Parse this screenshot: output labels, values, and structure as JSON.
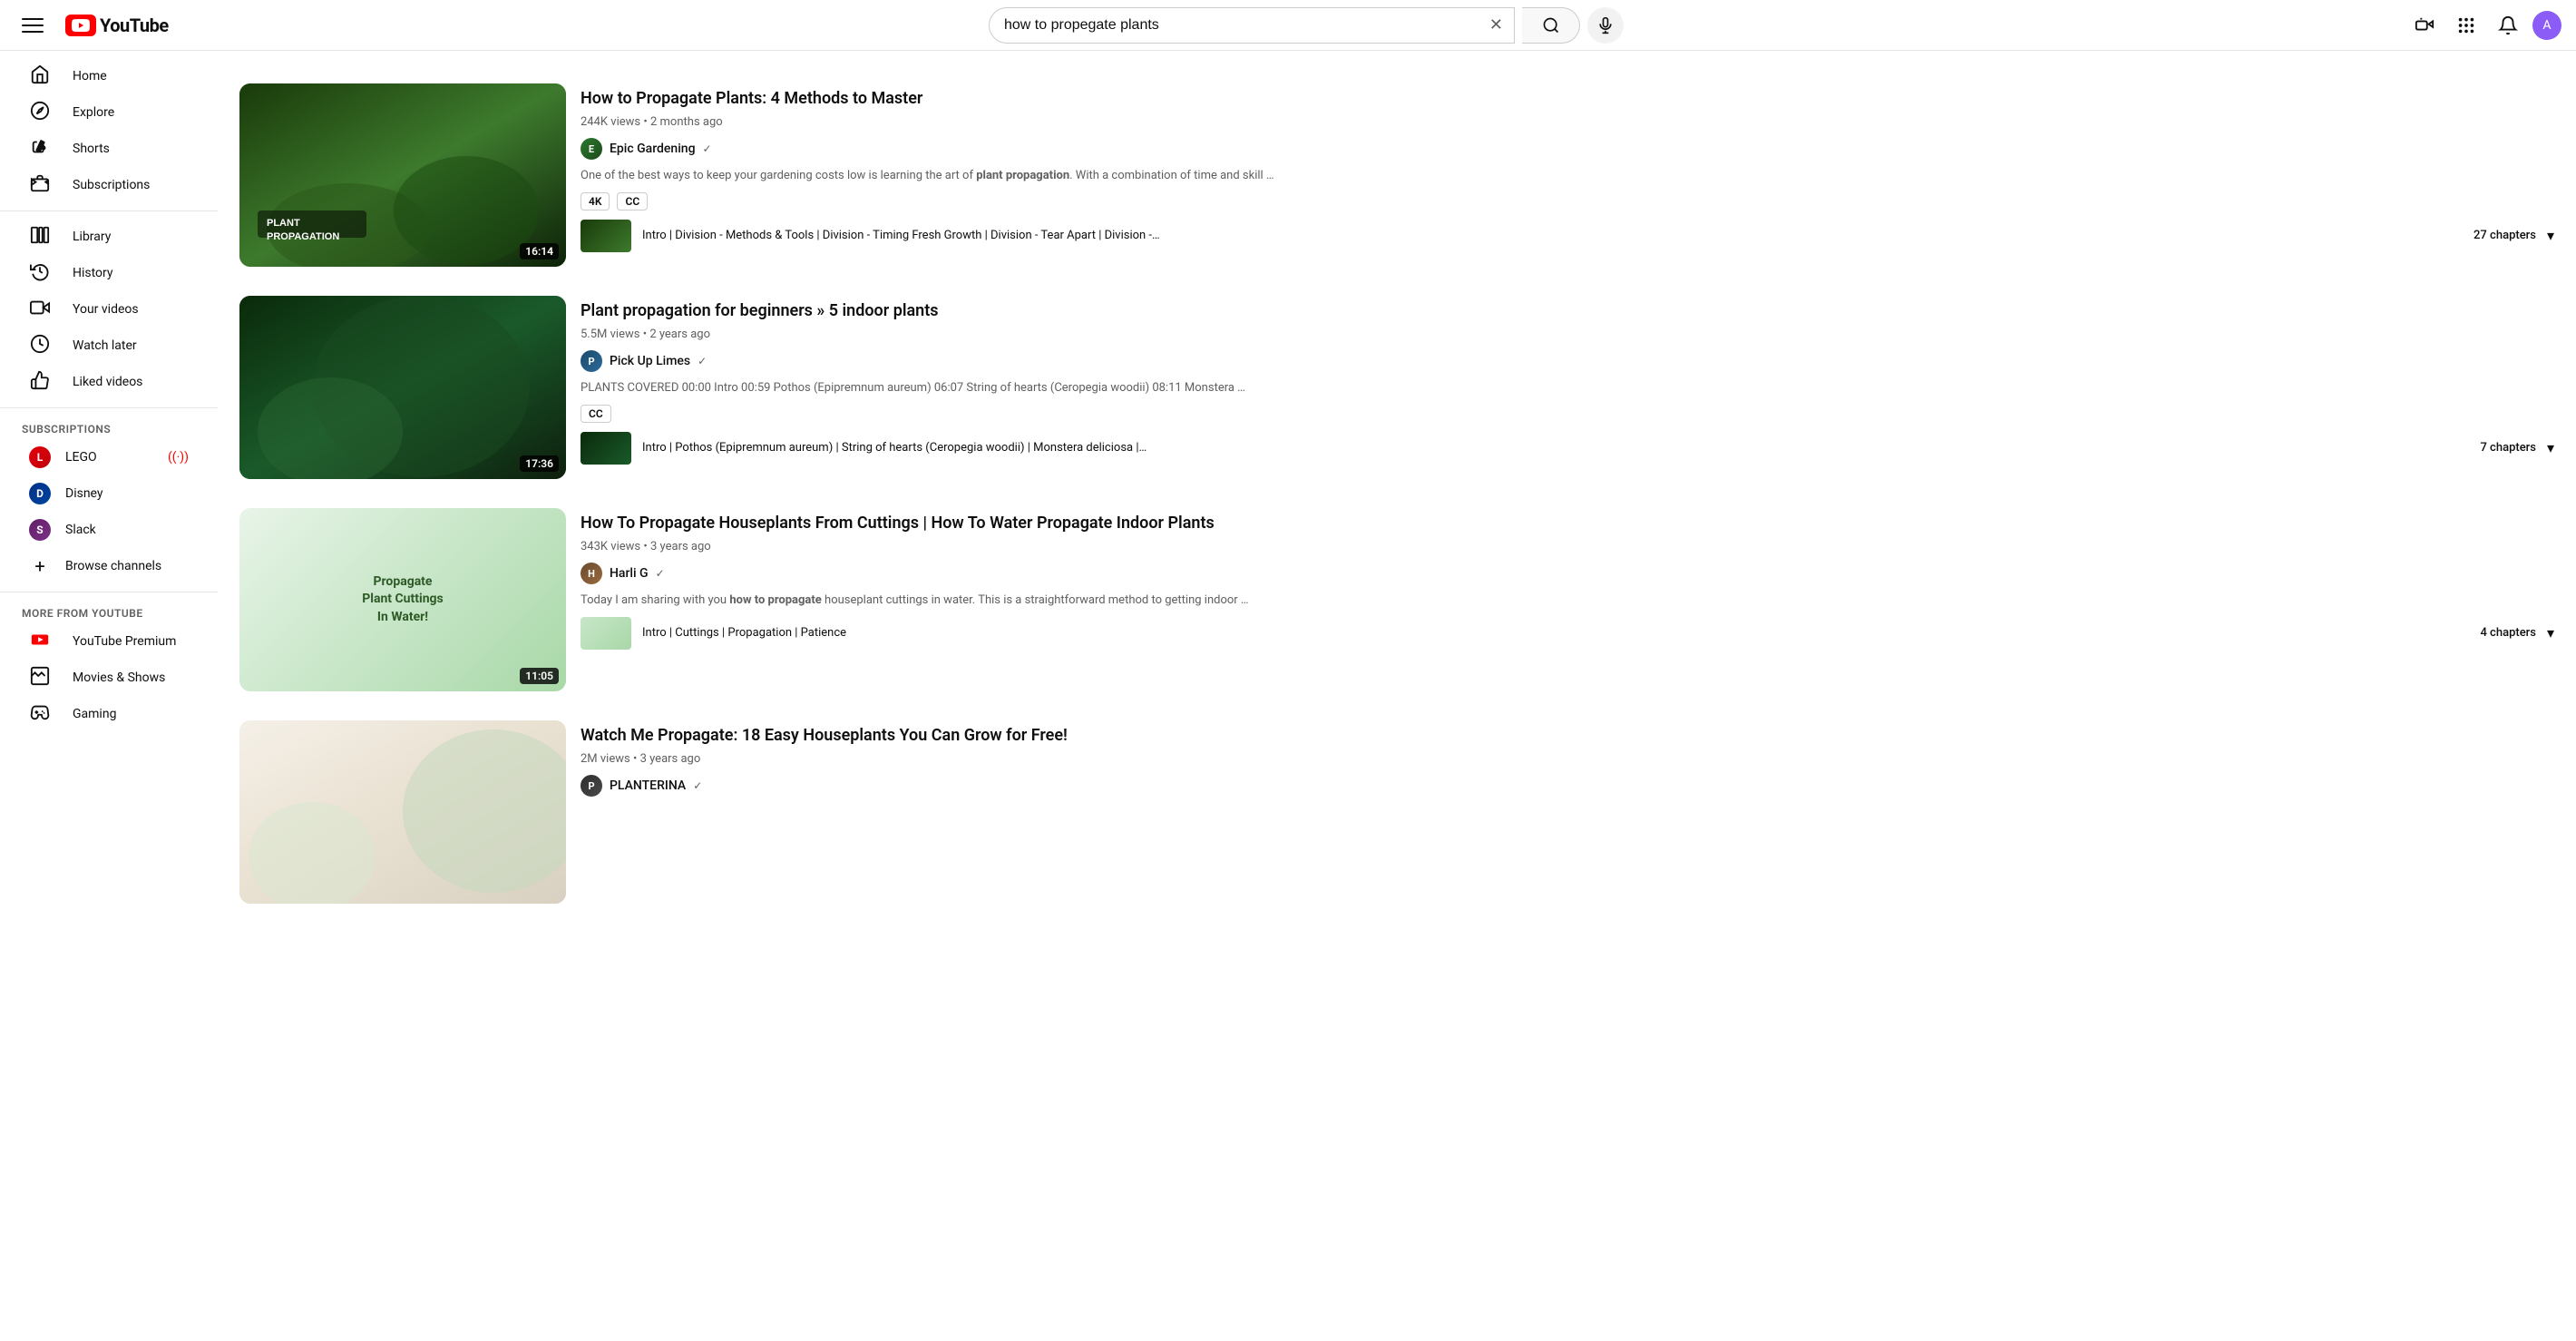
{
  "header": {
    "logo_text": "YouTube",
    "search_query": "how to propegate plants",
    "hamburger_label": "Menu",
    "create_label": "Create",
    "apps_label": "YouTube apps",
    "notifications_label": "Notifications",
    "account_label": "Account"
  },
  "sidebar": {
    "nav_items": [
      {
        "id": "home",
        "label": "Home",
        "icon": "⌂"
      },
      {
        "id": "explore",
        "label": "Explore",
        "icon": "🧭"
      },
      {
        "id": "shorts",
        "label": "Shorts",
        "icon": "▶"
      },
      {
        "id": "subscriptions",
        "label": "Subscriptions",
        "icon": "📋"
      }
    ],
    "library_items": [
      {
        "id": "library",
        "label": "Library",
        "icon": "📚"
      },
      {
        "id": "history",
        "label": "History",
        "icon": "🕐"
      },
      {
        "id": "your-videos",
        "label": "Your videos",
        "icon": "▶"
      },
      {
        "id": "watch-later",
        "label": "Watch later",
        "icon": "🕐"
      },
      {
        "id": "liked-videos",
        "label": "Liked videos",
        "icon": "👍"
      }
    ],
    "subscriptions_title": "SUBSCRIPTIONS",
    "subscriptions": [
      {
        "id": "lego",
        "label": "LEGO",
        "color": "#e3000b",
        "live": true,
        "initials": "L"
      },
      {
        "id": "disney",
        "label": "Disney",
        "color": "#003087",
        "live": false,
        "initials": "D"
      },
      {
        "id": "slack",
        "label": "Slack",
        "color": "#611f69",
        "live": false,
        "initials": "S"
      }
    ],
    "browse_channels_label": "Browse channels",
    "more_from_youtube_title": "MORE FROM YOUTUBE",
    "more_items": [
      {
        "id": "youtube-premium",
        "label": "YouTube Premium",
        "icon": "▶"
      },
      {
        "id": "movies-shows",
        "label": "Movies & Shows",
        "icon": "🎬"
      },
      {
        "id": "gaming",
        "label": "Gaming",
        "icon": "🎮"
      }
    ]
  },
  "results": [
    {
      "id": "result-1",
      "title": "How to Propagate Plants: 4 Methods to Master",
      "views": "244K views",
      "time_ago": "2 months ago",
      "channel": "Epic Gardening",
      "channel_verified": true,
      "channel_color": "#2d7a2d",
      "channel_initials": "E",
      "description": "One of the best ways to keep your gardening costs low is learning the art of plant propagation. With a combination of time and skill …",
      "badges": [
        "4K",
        "CC"
      ],
      "duration": "16:14",
      "chapters_text": "Intro | Division - Methods & Tools | Division - Timing Fresh Growth | Division - Tear Apart | Division -…",
      "chapters_count": "27 chapters",
      "thumb_type": "1"
    },
    {
      "id": "result-2",
      "title": "Plant propagation for beginners » 5 indoor plants",
      "views": "5.5M views",
      "time_ago": "2 years ago",
      "channel": "Pick Up Limes",
      "channel_verified": true,
      "channel_color": "#1a4a6a",
      "channel_initials": "P",
      "description": "PLANTS COVERED 00:00 Intro 00:59 Pothos (Epipremnum aureum) 06:07 String of hearts (Ceropegia woodii) 08:11 Monstera …",
      "badges": [
        "CC"
      ],
      "duration": "17:36",
      "chapters_text": "Intro | Pothos (Epipremnum aureum) | String of hearts (Ceropegia woodii) | Monstera deliciosa |…",
      "chapters_count": "7 chapters",
      "thumb_type": "2"
    },
    {
      "id": "result-3",
      "title": "How To Propagate Houseplants From Cuttings | How To Water Propagate Indoor Plants",
      "views": "343K views",
      "time_ago": "3 years ago",
      "channel": "Harli G",
      "channel_verified": true,
      "channel_color": "#6a4a2d",
      "channel_initials": "H",
      "description": "Today I am sharing with you how to propagate houseplant cuttings in water. This is a straightforward method to getting indoor …",
      "badges": [],
      "duration": "11:05",
      "chapters_text": "Intro | Cuttings | Propagation | Patience",
      "chapters_count": "4 chapters",
      "thumb_type": "3",
      "thumb_text": "Propagate\nPlant Cuttings\nIn Water!"
    },
    {
      "id": "result-4",
      "title": "Watch Me Propagate: 18 Easy Houseplants You Can Grow for Free!",
      "views": "2M views",
      "time_ago": "3 years ago",
      "channel": "PLANTERINA",
      "channel_verified": true,
      "channel_color": "#2d2d2d",
      "channel_initials": "P",
      "description": "",
      "badges": [],
      "duration": "",
      "chapters_text": "",
      "chapters_count": "",
      "thumb_type": "4"
    }
  ]
}
